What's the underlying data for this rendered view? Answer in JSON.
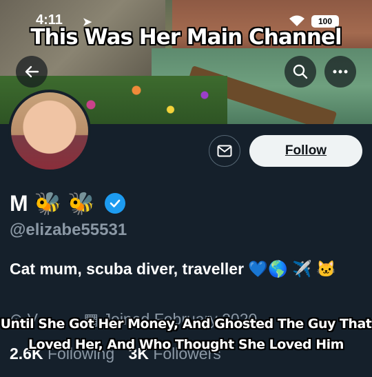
{
  "status_bar": {
    "time": "4:11",
    "battery": "100"
  },
  "captions": {
    "top": "This Was Her Main Channel",
    "bottom": "Until She Got Her Money, And Ghosted The Guy That Loved Her, And Who Thought She Loved Him"
  },
  "profile": {
    "display_name": "M 🐝 🐝",
    "handle": "@elizabe55531",
    "bio": "Cat mum, scuba diver, traveller 💙🌎 ✈️ 🐱",
    "location": "V",
    "joined": "Joined February 2020",
    "following_count": "2.6K",
    "following_label": "Following",
    "followers_count": "3K",
    "followers_label": "Followers"
  },
  "actions": {
    "follow_label": "Follow"
  },
  "icons": [
    "back-arrow-icon",
    "search-icon",
    "more-icon",
    "mail-icon",
    "verified-badge-icon",
    "location-icon",
    "calendar-icon"
  ],
  "colors": {
    "background": "#15202b",
    "accent": "#1d9bf0",
    "follow_bg": "#eff3f4",
    "muted": "#8b98a5"
  }
}
